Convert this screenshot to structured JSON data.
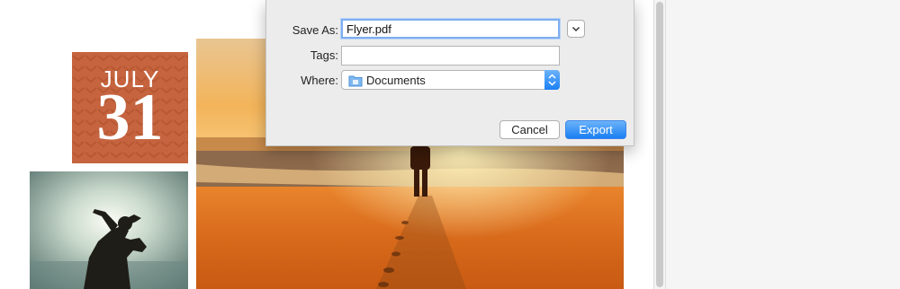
{
  "flyer": {
    "month": "JULY",
    "day": "31"
  },
  "dialog": {
    "save_as_label": "Save As:",
    "save_as_value": "Flyer.pdf",
    "tags_label": "Tags:",
    "tags_value": "",
    "where_label": "Where:",
    "where_value": "Documents",
    "cancel_label": "Cancel",
    "export_label": "Export"
  },
  "colors": {
    "date_block": "#c5643f",
    "accent_blue": "#1a7ff3",
    "dialog_background": "#ececec"
  },
  "icons": {
    "expand": "chevron-down-icon",
    "folder": "folder-icon",
    "stepper": "up-down-stepper-icon"
  }
}
